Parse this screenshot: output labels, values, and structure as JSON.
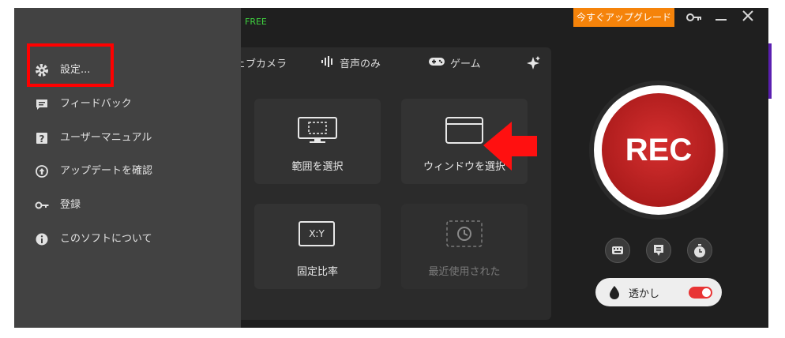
{
  "topbar": {
    "free_label": "FREE",
    "upgrade_label": "今すぐアップグレード",
    "icons": [
      "key-icon",
      "minimize-icon",
      "close-icon"
    ]
  },
  "modes": [
    {
      "label": "ェブカメラ",
      "icon": "webcam-icon"
    },
    {
      "label": "音声のみ",
      "icon": "audio-wave-icon"
    },
    {
      "label": "ゲーム",
      "icon": "gamepad-icon"
    }
  ],
  "tiles": [
    {
      "label": "範囲を選択",
      "icon": "region-select-icon"
    },
    {
      "label": "ウィンドウを選択",
      "icon": "window-select-icon"
    },
    {
      "label": "固定比率",
      "icon": "fixed-ratio-icon",
      "icon_text": "X:Y"
    },
    {
      "label": "最近使用された",
      "icon": "recent-icon"
    }
  ],
  "rec": {
    "label": "REC"
  },
  "watermark": {
    "label": "透かし",
    "enabled": true
  },
  "menu": {
    "items": [
      {
        "label": "設定...",
        "icon": "gear-icon"
      },
      {
        "label": "フィードバック",
        "icon": "feedback-icon"
      },
      {
        "label": "ユーザーマニュアル",
        "icon": "help-icon"
      },
      {
        "label": "アップデートを確認",
        "icon": "update-icon"
      },
      {
        "label": "登録",
        "icon": "key-icon"
      },
      {
        "label": "このソフトについて",
        "icon": "info-icon"
      }
    ]
  },
  "colors": {
    "accent": "#f5830a",
    "rec": "#c21f1f",
    "highlight": "#ff0000",
    "free": "#3fd13f"
  }
}
